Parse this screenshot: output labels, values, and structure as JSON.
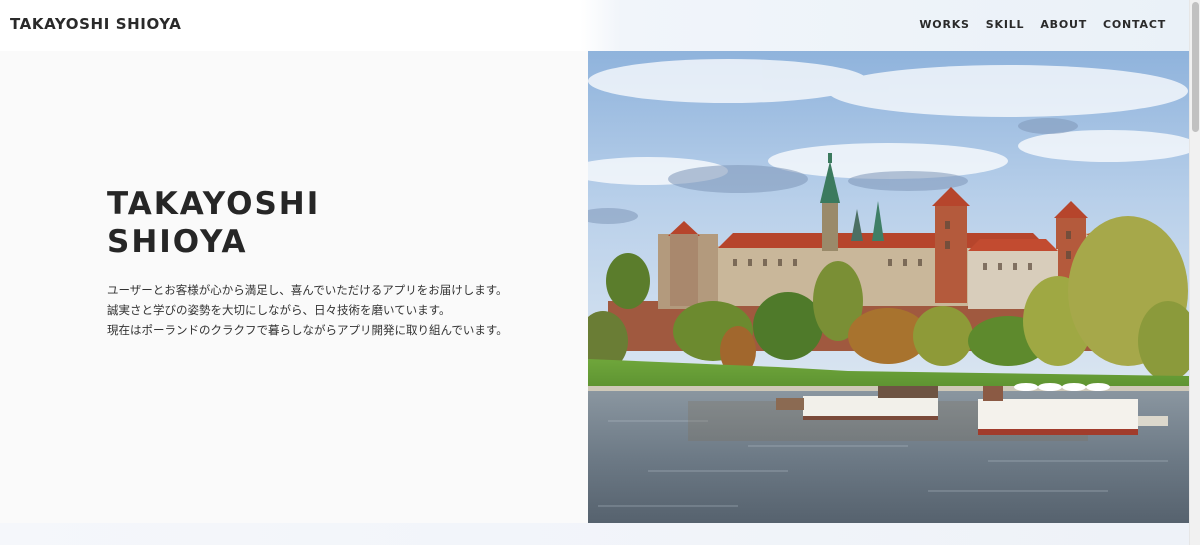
{
  "header": {
    "brand": "TAKAYOSHI SHIOYA",
    "nav": [
      {
        "label": "WORKS"
      },
      {
        "label": "SKILL"
      },
      {
        "label": "ABOUT"
      },
      {
        "label": "CONTACT"
      }
    ]
  },
  "hero": {
    "title_line1": "TAKAYOSHI",
    "title_line2": "SHIOYA",
    "description": [
      "ユーザーとお客様が心から満足し、喜んでいただけるアプリをお届けします。",
      "誠実さと学びの姿勢を大切にしながら、日々技術を磨いています。",
      "現在はポーランドのクラクフで暮らしながらアプリ開発に取り組んでいます。"
    ]
  },
  "colors": {
    "text": "#262626",
    "sky": "#a9c6e6",
    "river": "#6f7f8f",
    "castle_roof": "#b6452c",
    "grass": "#5b8f32"
  }
}
